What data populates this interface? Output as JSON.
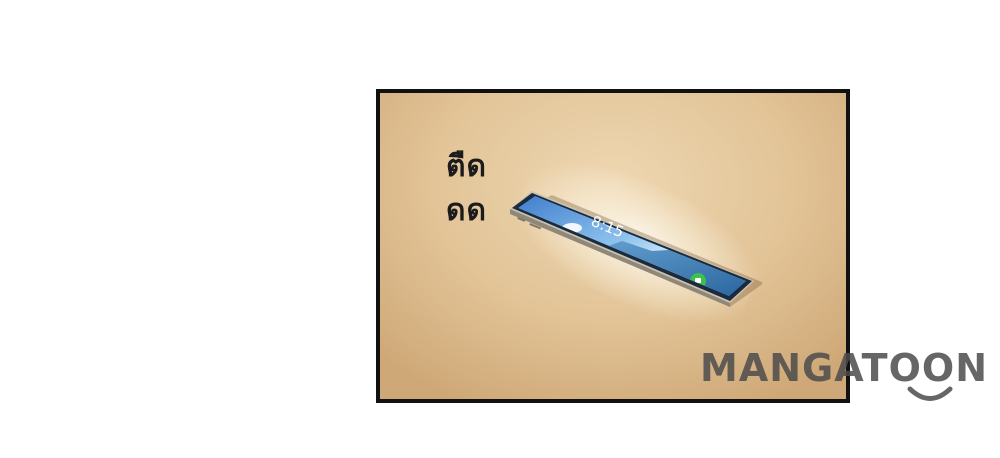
{
  "panel": {
    "sound_effect_lines": [
      "ตืด",
      "ดด"
    ],
    "phone": {
      "clock": "8:15"
    }
  },
  "watermark": {
    "text": "MANGATOON"
  },
  "colors": {
    "panel_border": "#111111",
    "panel_bg": "#e2c497",
    "watermark": "#4b4b4b",
    "call_button": "#3fbf4f"
  }
}
